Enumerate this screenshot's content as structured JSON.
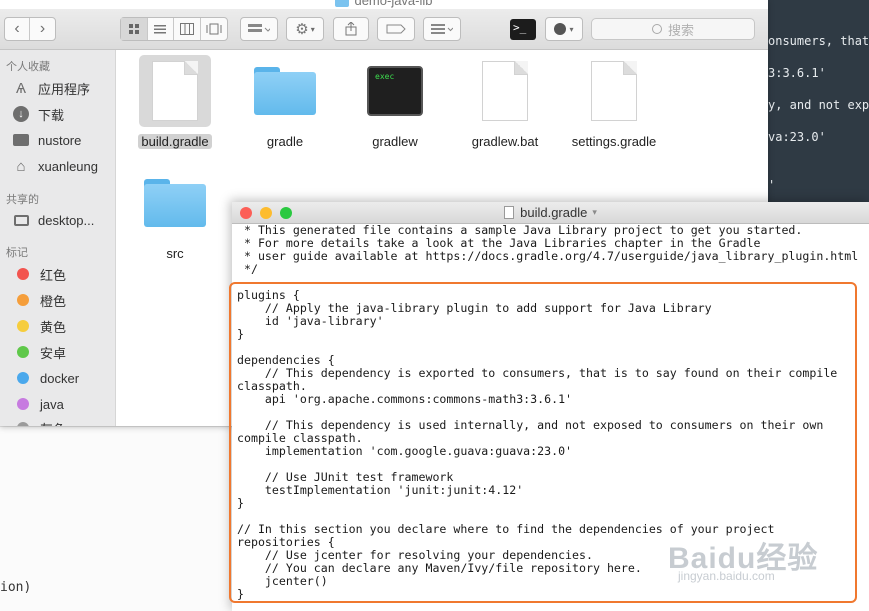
{
  "finder": {
    "title": "demo-java-lib",
    "search_placeholder": "搜索",
    "sidebar": {
      "sections": [
        {
          "header": "个人收藏",
          "items": [
            {
              "label": "应用程序",
              "icon": "applications-icon"
            },
            {
              "label": "下载",
              "icon": "download-icon"
            },
            {
              "label": "nustore",
              "icon": "folder-icon"
            },
            {
              "label": "xuanleung",
              "icon": "home-icon"
            }
          ]
        },
        {
          "header": "共享的",
          "items": [
            {
              "label": "desktop...",
              "icon": "computer-icon"
            }
          ]
        },
        {
          "header": "标记",
          "tags": [
            {
              "label": "红色",
              "color": "#f2544f"
            },
            {
              "label": "橙色",
              "color": "#f59e3b"
            },
            {
              "label": "黄色",
              "color": "#f6cd3d"
            },
            {
              "label": "安卓",
              "color": "#5fc84a"
            },
            {
              "label": "docker",
              "color": "#4aa8ec"
            },
            {
              "label": "java",
              "color": "#c77be0"
            },
            {
              "label": "灰色",
              "color": "#9b9b9b"
            }
          ]
        }
      ]
    },
    "files": [
      {
        "name": "build.gradle",
        "kind": "document",
        "selected": true
      },
      {
        "name": "gradle",
        "kind": "folder"
      },
      {
        "name": "gradlew",
        "kind": "executable",
        "badge": "exec"
      },
      {
        "name": "gradlew.bat",
        "kind": "document"
      },
      {
        "name": "settings.gradle",
        "kind": "document"
      },
      {
        "name": "src",
        "kind": "folder"
      }
    ]
  },
  "editor": {
    "title": "build.gradle",
    "lines": [
      " * This generated file contains a sample Java Library project to get you started.",
      " * For more details take a look at the Java Libraries chapter in the Gradle",
      " * user guide available at https://docs.gradle.org/4.7/userguide/java_library_plugin.html",
      " */",
      "",
      "plugins {",
      "    // Apply the java-library plugin to add support for Java Library",
      "    id 'java-library'",
      "}",
      "",
      "dependencies {",
      "    // This dependency is exported to consumers, that is to say found on their compile",
      "classpath.",
      "    api 'org.apache.commons:commons-math3:3.6.1'",
      "",
      "    // This dependency is used internally, and not exposed to consumers on their own",
      "compile classpath.",
      "    implementation 'com.google.guava:guava:23.0'",
      "",
      "    // Use JUnit test framework",
      "    testImplementation 'junit:junit:4.12'",
      "}",
      "",
      "// In this section you declare where to find the dependencies of your project",
      "repositories {",
      "    // Use jcenter for resolving your dependencies.",
      "    // You can declare any Maven/Ivy/file repository here.",
      "    jcenter()",
      "}"
    ],
    "highlight_color": "#f0782f"
  },
  "background_terminal": {
    "lines": [
      "onsumers, that i",
      "3:3.6.1'",
      "y, and not expo",
      "va:23.0'",
      "'"
    ]
  },
  "background_editor": {
    "fragment": "ion)"
  },
  "watermark": {
    "brand": "Baidu经验",
    "url": "jingyan.baidu.com"
  }
}
